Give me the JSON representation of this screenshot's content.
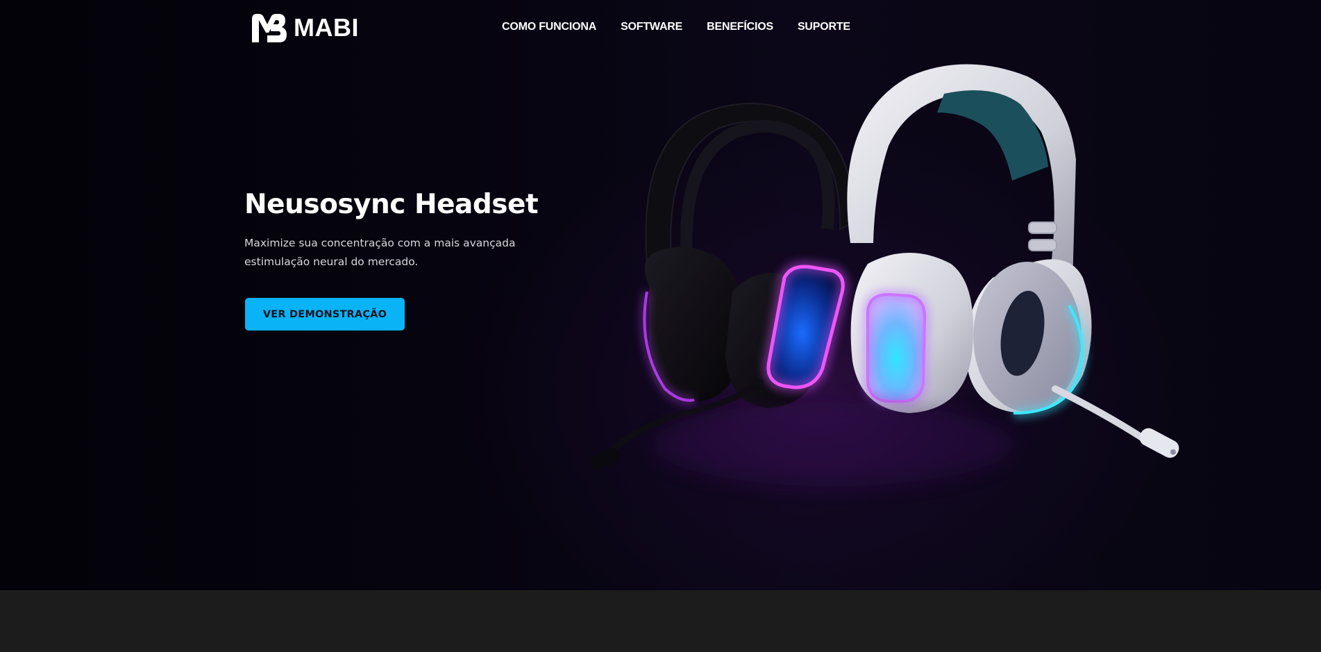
{
  "header": {
    "logo_text": "MABI",
    "nav": [
      {
        "label": "COMO FUNCIONA"
      },
      {
        "label": "SOFTWARE"
      },
      {
        "label": "BENEFÍCIOS"
      },
      {
        "label": "SUPORTE"
      }
    ]
  },
  "hero": {
    "title": "Neusosync Headset",
    "subtitle": "Maximize sua concentração com a mais avançada estimulação neural do mercado.",
    "cta_label": "VER DEMONSTRAÇÃO"
  },
  "colors": {
    "background": "#05030c",
    "accent": "#0ab3f5",
    "glow_purple": "#b43cff",
    "glow_cyan": "#35d6ff",
    "footer": "#1c1c1c"
  },
  "icons": {
    "logo_mark": "mabi-logo-icon"
  }
}
